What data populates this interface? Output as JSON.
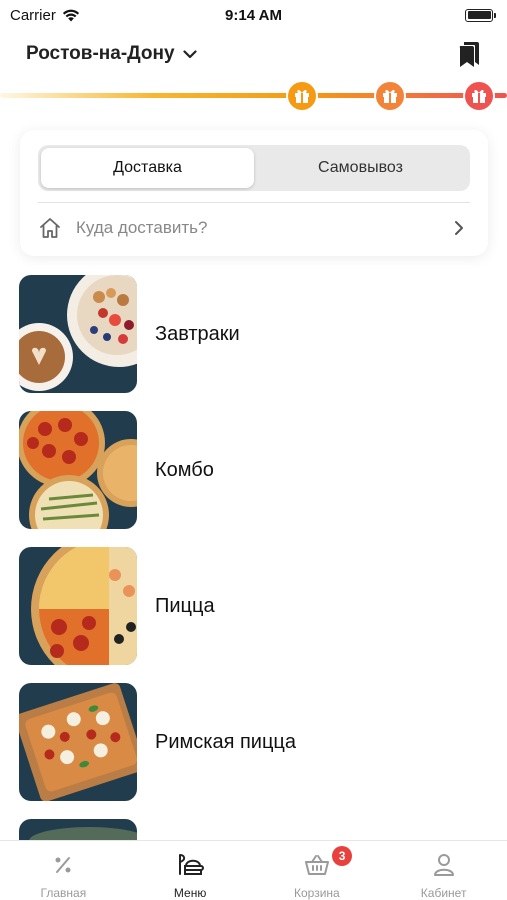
{
  "status_bar": {
    "carrier": "Carrier",
    "time": "9:14 AM"
  },
  "header": {
    "city": "Ростов-на-Дону"
  },
  "delivery": {
    "tabs": [
      {
        "label": "Доставка",
        "active": true
      },
      {
        "label": "Самовывоз",
        "active": false
      }
    ],
    "address_placeholder": "Куда доставить?"
  },
  "categories": [
    {
      "label": "Завтраки"
    },
    {
      "label": "Комбо"
    },
    {
      "label": "Пицца"
    },
    {
      "label": "Римская пицца"
    }
  ],
  "tab_bar": {
    "items": [
      {
        "label": "Главная",
        "icon": "percent-icon",
        "active": false
      },
      {
        "label": "Меню",
        "icon": "menu-food-icon",
        "active": true
      },
      {
        "label": "Корзина",
        "icon": "basket-icon",
        "active": false,
        "badge": "3"
      },
      {
        "label": "Кабинет",
        "icon": "user-icon",
        "active": false
      }
    ]
  },
  "colors": {
    "accent_orange": "#f59a12",
    "accent_red": "#ef5350",
    "badge_red": "#e8413d",
    "thumb_bg": "#1f3a4a"
  }
}
